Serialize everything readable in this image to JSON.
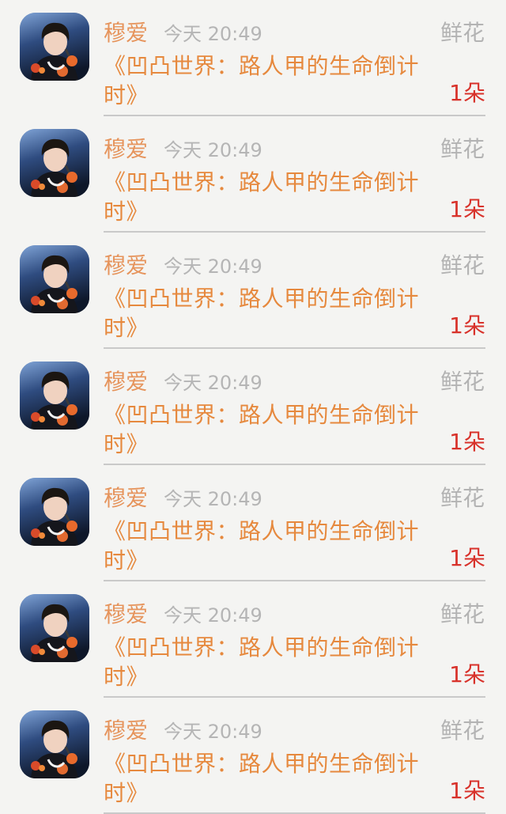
{
  "colors": {
    "background": "#f4f4f2",
    "username": "#e6945c",
    "time": "#b5b5b5",
    "gift_type": "#b3b3b3",
    "book_title": "#e6893e",
    "amount": "#d8322b",
    "divider": "#c9c9c9"
  },
  "items": [
    {
      "avatar": "user-avatar",
      "username": "穆爱",
      "time": "今天 20:49",
      "gift_type": "鲜花",
      "title": "《凹凸世界：路人甲的生命倒计时》",
      "amount": "1朵"
    },
    {
      "avatar": "user-avatar",
      "username": "穆爱",
      "time": "今天 20:49",
      "gift_type": "鲜花",
      "title": "《凹凸世界：路人甲的生命倒计时》",
      "amount": "1朵"
    },
    {
      "avatar": "user-avatar",
      "username": "穆爱",
      "time": "今天 20:49",
      "gift_type": "鲜花",
      "title": "《凹凸世界：路人甲的生命倒计时》",
      "amount": "1朵"
    },
    {
      "avatar": "user-avatar",
      "username": "穆爱",
      "time": "今天 20:49",
      "gift_type": "鲜花",
      "title": "《凹凸世界：路人甲的生命倒计时》",
      "amount": "1朵"
    },
    {
      "avatar": "user-avatar",
      "username": "穆爱",
      "time": "今天 20:49",
      "gift_type": "鲜花",
      "title": "《凹凸世界：路人甲的生命倒计时》",
      "amount": "1朵"
    },
    {
      "avatar": "user-avatar",
      "username": "穆爱",
      "time": "今天 20:49",
      "gift_type": "鲜花",
      "title": "《凹凸世界：路人甲的生命倒计时》",
      "amount": "1朵"
    },
    {
      "avatar": "user-avatar",
      "username": "穆爱",
      "time": "今天 20:49",
      "gift_type": "鲜花",
      "title": "《凹凸世界：路人甲的生命倒计时》",
      "amount": "1朵"
    }
  ]
}
